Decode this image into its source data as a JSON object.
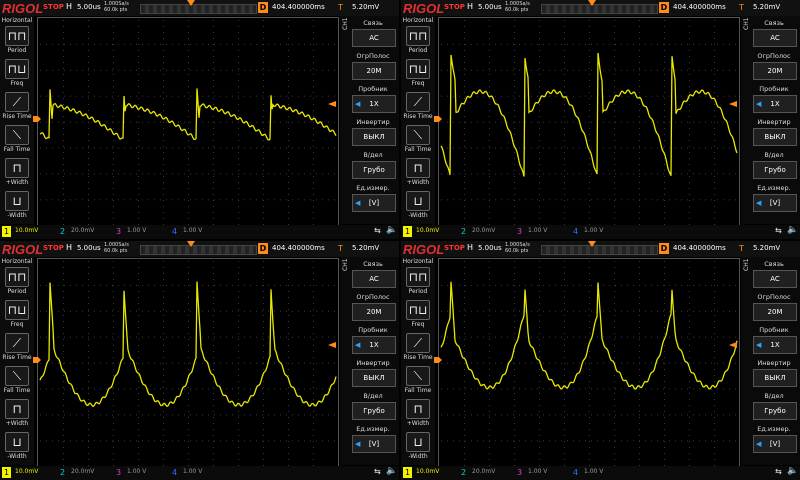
{
  "scope": {
    "logo": "RIGOL",
    "run_state": "STOP",
    "horizontal_label": "H",
    "timebase": "5.00us",
    "sample_rate": "1.000Sa/s",
    "memory_depth": "60.0k pts",
    "delay_label": "D",
    "delay_value": "404.400000ms",
    "trigger_label": "T",
    "trigger_level": "5.20mV"
  },
  "left_menu": {
    "title": "Horizontal",
    "items": [
      {
        "label": "Period",
        "icon": "period-icon",
        "glyph": "⊓⊓"
      },
      {
        "label": "Freq",
        "icon": "frequency-icon",
        "glyph": "⊓⊔"
      },
      {
        "label": "Rise Time",
        "icon": "rise-time-icon",
        "glyph": "⟋"
      },
      {
        "label": "Fall Time",
        "icon": "fall-time-icon",
        "glyph": "⟍"
      },
      {
        "label": "+Width",
        "icon": "positive-width-icon",
        "glyph": "⊓"
      },
      {
        "label": "-Width",
        "icon": "negative-width-icon",
        "glyph": "⊔"
      }
    ]
  },
  "right_menu": {
    "channel_tag": "CH1",
    "items": [
      {
        "label": "Связь",
        "value": "AC",
        "arrow": false
      },
      {
        "label": "ОгрПолос",
        "value": "20M",
        "arrow": false
      },
      {
        "label": "Пробник",
        "value": "1X",
        "arrow": true
      },
      {
        "label": "Инвертир",
        "value": "ВЫКЛ",
        "arrow": false
      },
      {
        "label": "В/дел",
        "value": "Грубо",
        "arrow": false
      },
      {
        "label": "Ед.измер.",
        "value": "[V]",
        "arrow": true
      }
    ]
  },
  "channels": [
    {
      "num": "1",
      "scale": "10.0mV",
      "color": "#f4f400"
    },
    {
      "num": "2",
      "scale": "20.0mV",
      "color": "#00d0d0"
    },
    {
      "num": "3",
      "scale": "1.00 V",
      "color": "#d040d0"
    },
    {
      "num": "4",
      "scale": "1.00 V",
      "color": "#3070ff"
    }
  ],
  "colors": {
    "trace": "#e8e800",
    "accent": "#ff8c1a",
    "brand": "#e03030"
  },
  "panels": [
    {
      "name": "top-left-scope",
      "waveform": "sawtooth-low-amplitude"
    },
    {
      "name": "top-right-scope",
      "waveform": "sawtooth-medium-amplitude"
    },
    {
      "name": "bottom-left-scope",
      "waveform": "sawtooth-high-amplitude"
    },
    {
      "name": "bottom-right-scope",
      "waveform": "sawtooth-high-amplitude-dip"
    }
  ]
}
